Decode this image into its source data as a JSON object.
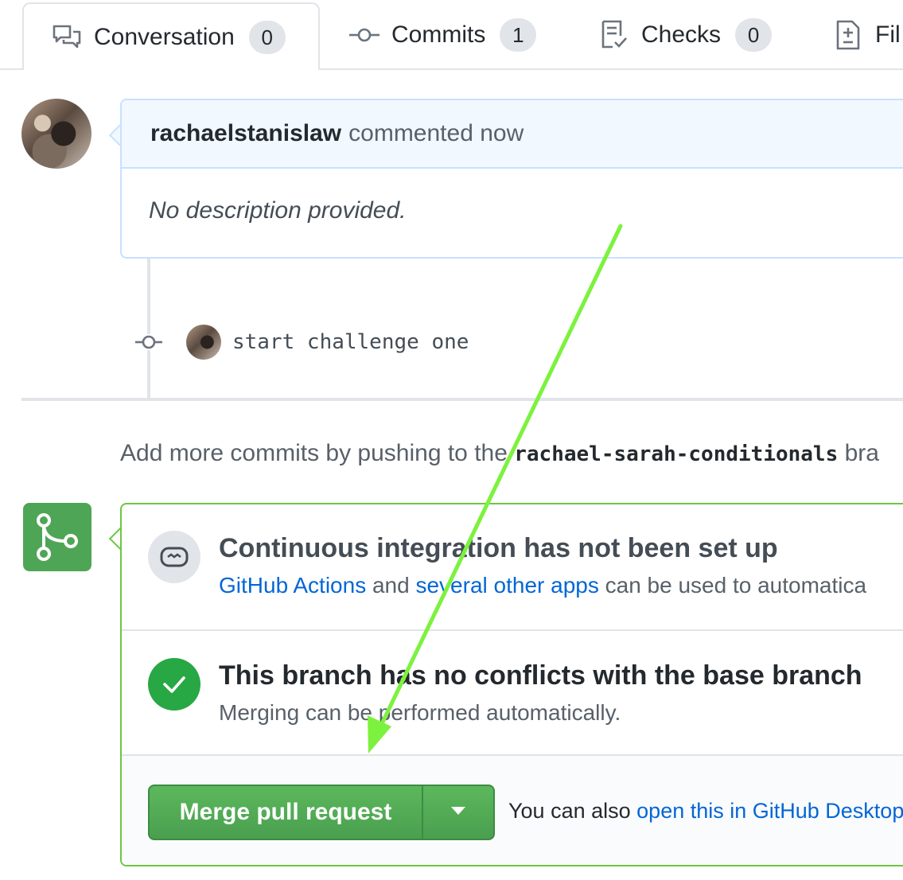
{
  "tabs": [
    {
      "label": "Conversation",
      "count": "0",
      "icon": "conversation-icon"
    },
    {
      "label": "Commits",
      "count": "1",
      "icon": "commit-icon"
    },
    {
      "label": "Checks",
      "count": "0",
      "icon": "checklist-icon"
    },
    {
      "label": "Fil",
      "icon": "file-diff-icon"
    }
  ],
  "comment": {
    "author": "rachaelstanislaw",
    "action": "commented now",
    "body": "No description provided."
  },
  "commit": {
    "message": "start challenge one"
  },
  "add_more": {
    "prefix": "Add more commits by pushing to the",
    "branch": "rachael-sarah-conditionals",
    "suffix": "bra"
  },
  "ci": {
    "title": "Continuous integration has not been set up",
    "link1": "GitHub Actions",
    "and": "and",
    "link2": "several other apps",
    "rest": "can be used to automatica"
  },
  "conflicts": {
    "title": "This branch has no conflicts with the base branch",
    "desc": "Merging can be performed automatically."
  },
  "merge": {
    "button_label": "Merge pull request",
    "also_prefix": "You can also",
    "also_link": "open this in GitHub Desktop"
  },
  "colors": {
    "link": "#0366d6",
    "merge_green": "#4fa556",
    "annotation_arrow": "#7cf23e"
  }
}
